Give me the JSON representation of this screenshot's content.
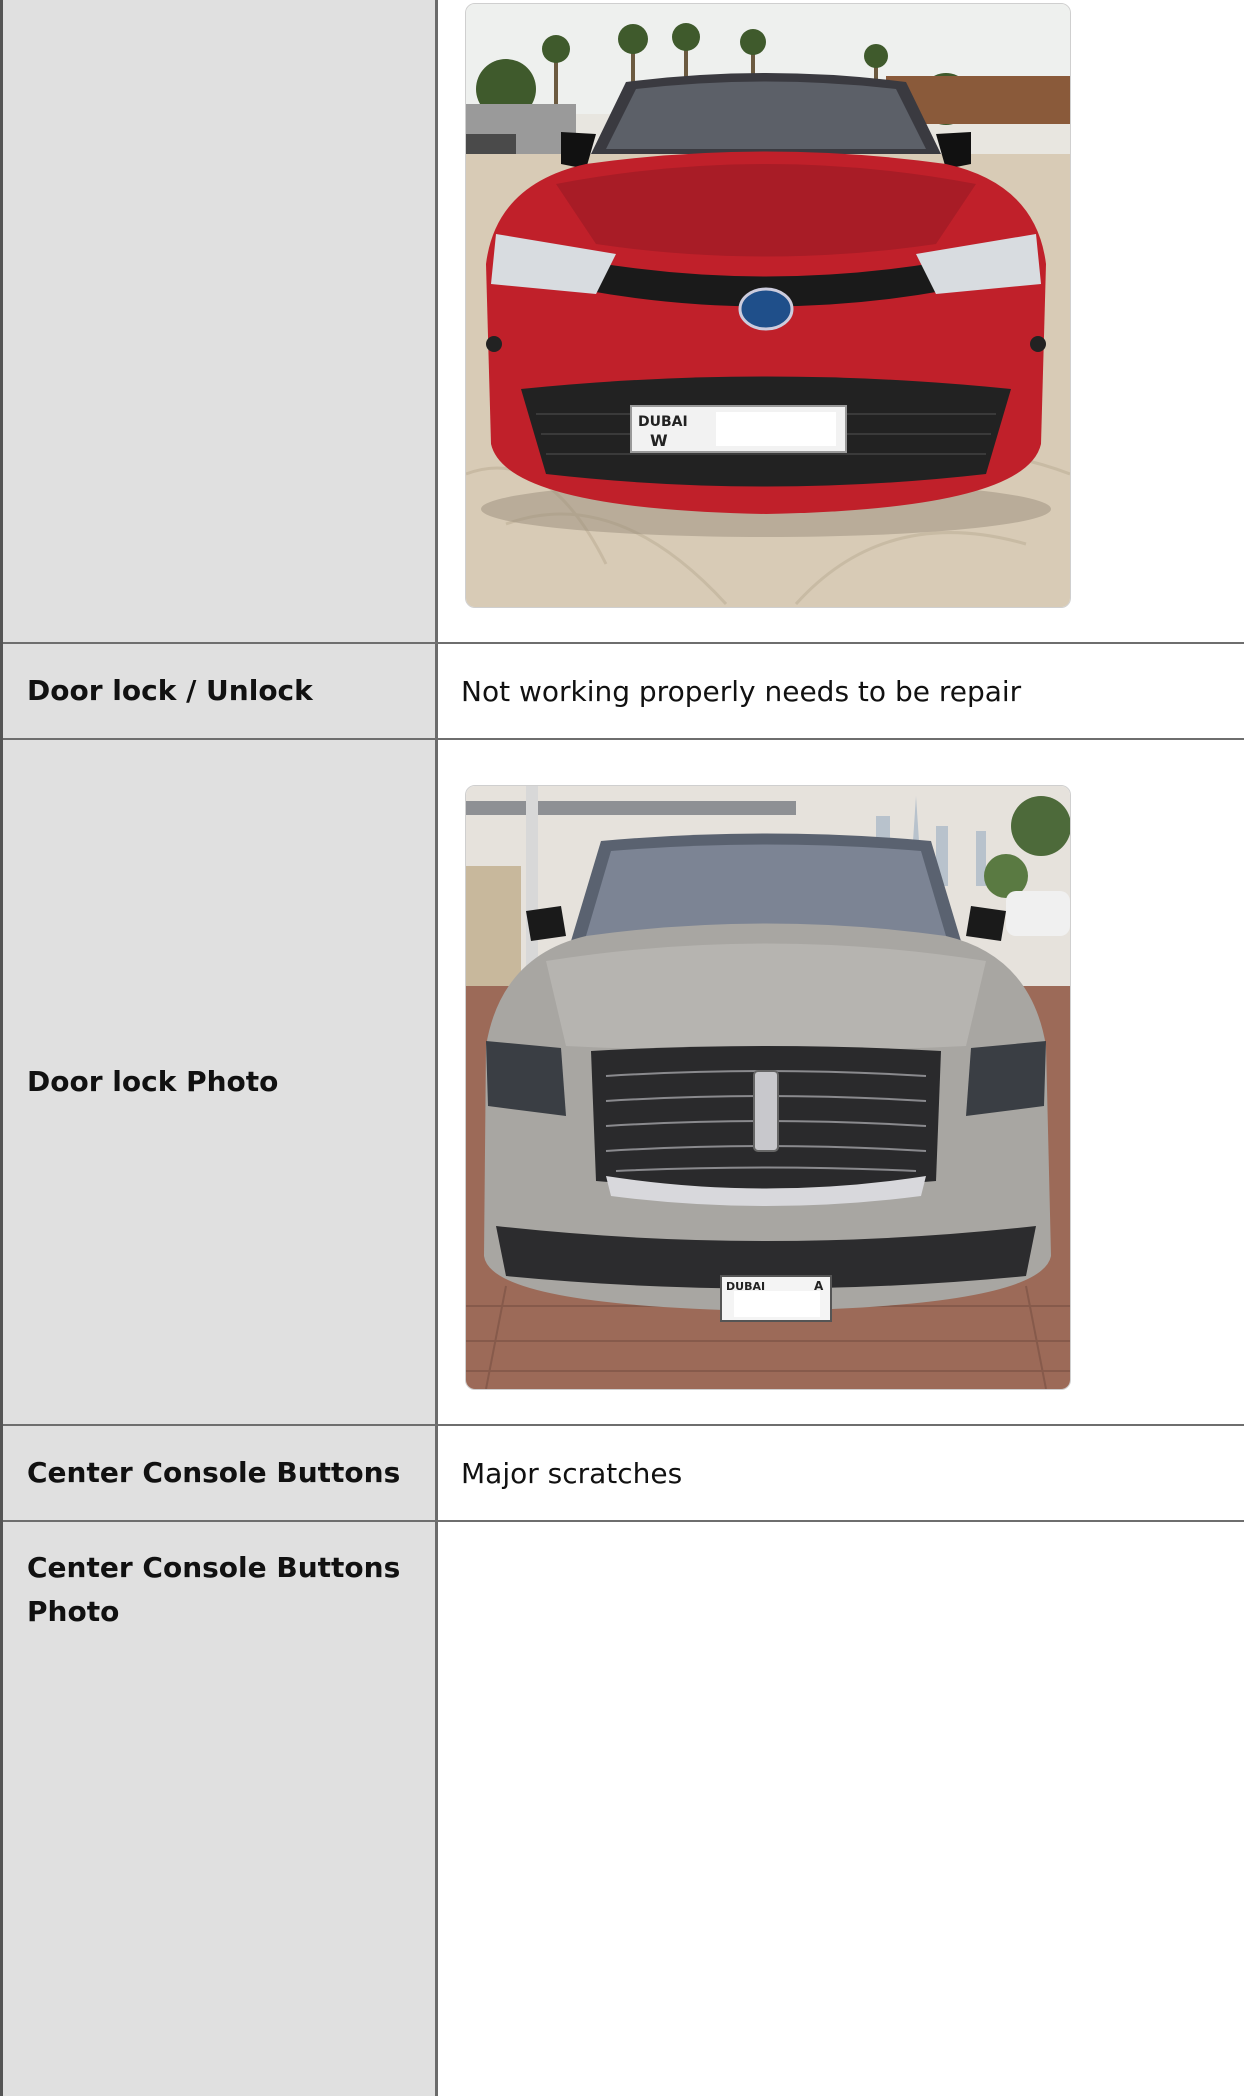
{
  "rows": [
    {
      "label": "",
      "value": "",
      "photo": "red-toyota-photo"
    },
    {
      "label": "Door lock / Unlock",
      "value": "Not working properly needs to be repair"
    },
    {
      "label": "Door lock Photo",
      "value": "",
      "photo": "grey-lincoln-photo"
    },
    {
      "label": "Center Console Buttons",
      "value": "Major scratches"
    },
    {
      "label": "Center Console Buttons Photo",
      "value": ""
    }
  ],
  "plates": {
    "toyota": {
      "emirate": "DUBAI",
      "code": "W"
    },
    "lincoln": {
      "emirate": "DUBAI",
      "code": "A"
    }
  },
  "colors": {
    "label_bg": "#e0e0e0",
    "border": "#6e6e6e",
    "toyota_body": "#c0202a",
    "lincoln_body": "#a8a6a2"
  }
}
